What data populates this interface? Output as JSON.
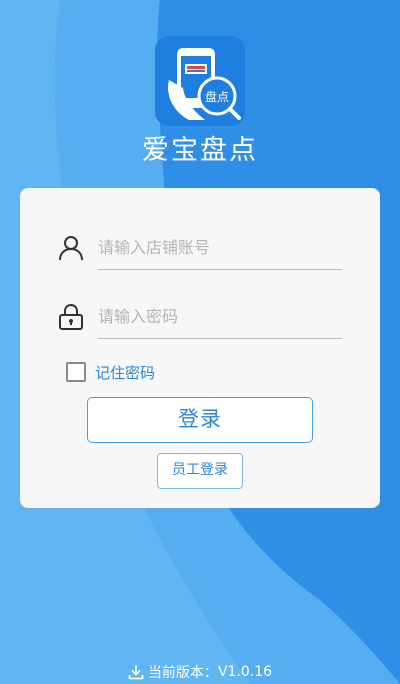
{
  "app": {
    "name": "爱宝盘点",
    "logo_badge": "盘点"
  },
  "form": {
    "account_placeholder": "请输入店铺账号",
    "password_placeholder": "请输入密码",
    "remember_label": "记住密码",
    "remember_checked": false,
    "login_label": "登录",
    "staff_login_label": "员工登录"
  },
  "footer": {
    "version_label": "当前版本：",
    "version_value": "V1.0.16"
  },
  "colors": {
    "background": "#2f8ee6",
    "wave_light": "#5fb6f3",
    "accent": "#2e86d6",
    "card": "#f7f7f7"
  },
  "icons": [
    "user-icon",
    "lock-icon",
    "download-icon"
  ]
}
